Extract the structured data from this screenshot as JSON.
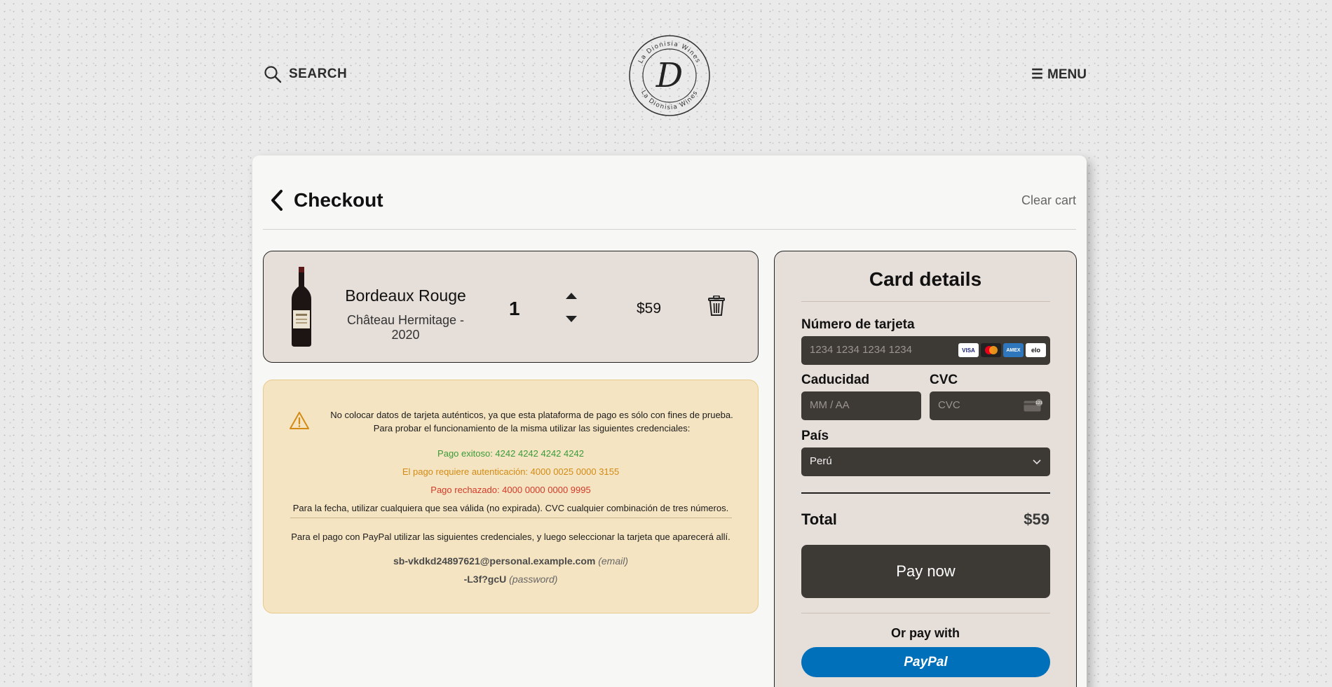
{
  "header": {
    "search_label": "SEARCH",
    "menu_label": "MENU",
    "logo_text": "La Dionisia Wines",
    "logo_letter": "D"
  },
  "checkout": {
    "title": "Checkout",
    "clear_cart_label": "Clear cart"
  },
  "cart_item": {
    "name": "Bordeaux Rouge",
    "subtitle": "Château Hermitage - 2020",
    "quantity": "1",
    "price": "$59"
  },
  "notice": {
    "line1": "No colocar datos de tarjeta auténticos, ya que esta plataforma de pago es sólo con fines de prueba.",
    "line2": "Para probar el funcionamiento de la misma utilizar las siguientes credenciales:",
    "success": "Pago exitoso: 4242 4242 4242 4242",
    "auth_required": "El pago requiere autenticación: 4000 0025 0000 3155",
    "rejected": "Pago rechazado: 4000 0000 0000 9995",
    "date_note": "Para la fecha, utilizar cualquiera que sea válida (no expirada). CVC cualquier combinación de tres números.",
    "paypal_note": "Para el pago con PayPal utilizar las siguientes credenciales, y luego seleccionar la tarjeta que aparecerá allí.",
    "email_value": "sb-vkdkd24897621@personal.example.com",
    "email_tag": "(email)",
    "password_value": "-L3f?gcU",
    "password_tag": "(password)"
  },
  "card_panel": {
    "title": "Card details",
    "card_number_label": "Número de tarjeta",
    "card_number_placeholder": "1234 1234 1234 1234",
    "brands": [
      "VISA",
      "mastercard",
      "AMEX",
      "elo"
    ],
    "expiry_label": "Caducidad",
    "expiry_placeholder": "MM / AA",
    "cvc_label": "CVC",
    "cvc_placeholder": "CVC",
    "country_label": "País",
    "country_value": "Perú",
    "total_label": "Total",
    "total_value": "$59",
    "pay_label": "Pay now",
    "or_pay_label": "Or pay with",
    "paypal_label": "PayPal"
  },
  "colors": {
    "accent_dark": "#3d3935",
    "panel_bg": "#e6ded8",
    "notice_bg": "#f5e4c1",
    "paypal_blue": "#0070ba"
  }
}
